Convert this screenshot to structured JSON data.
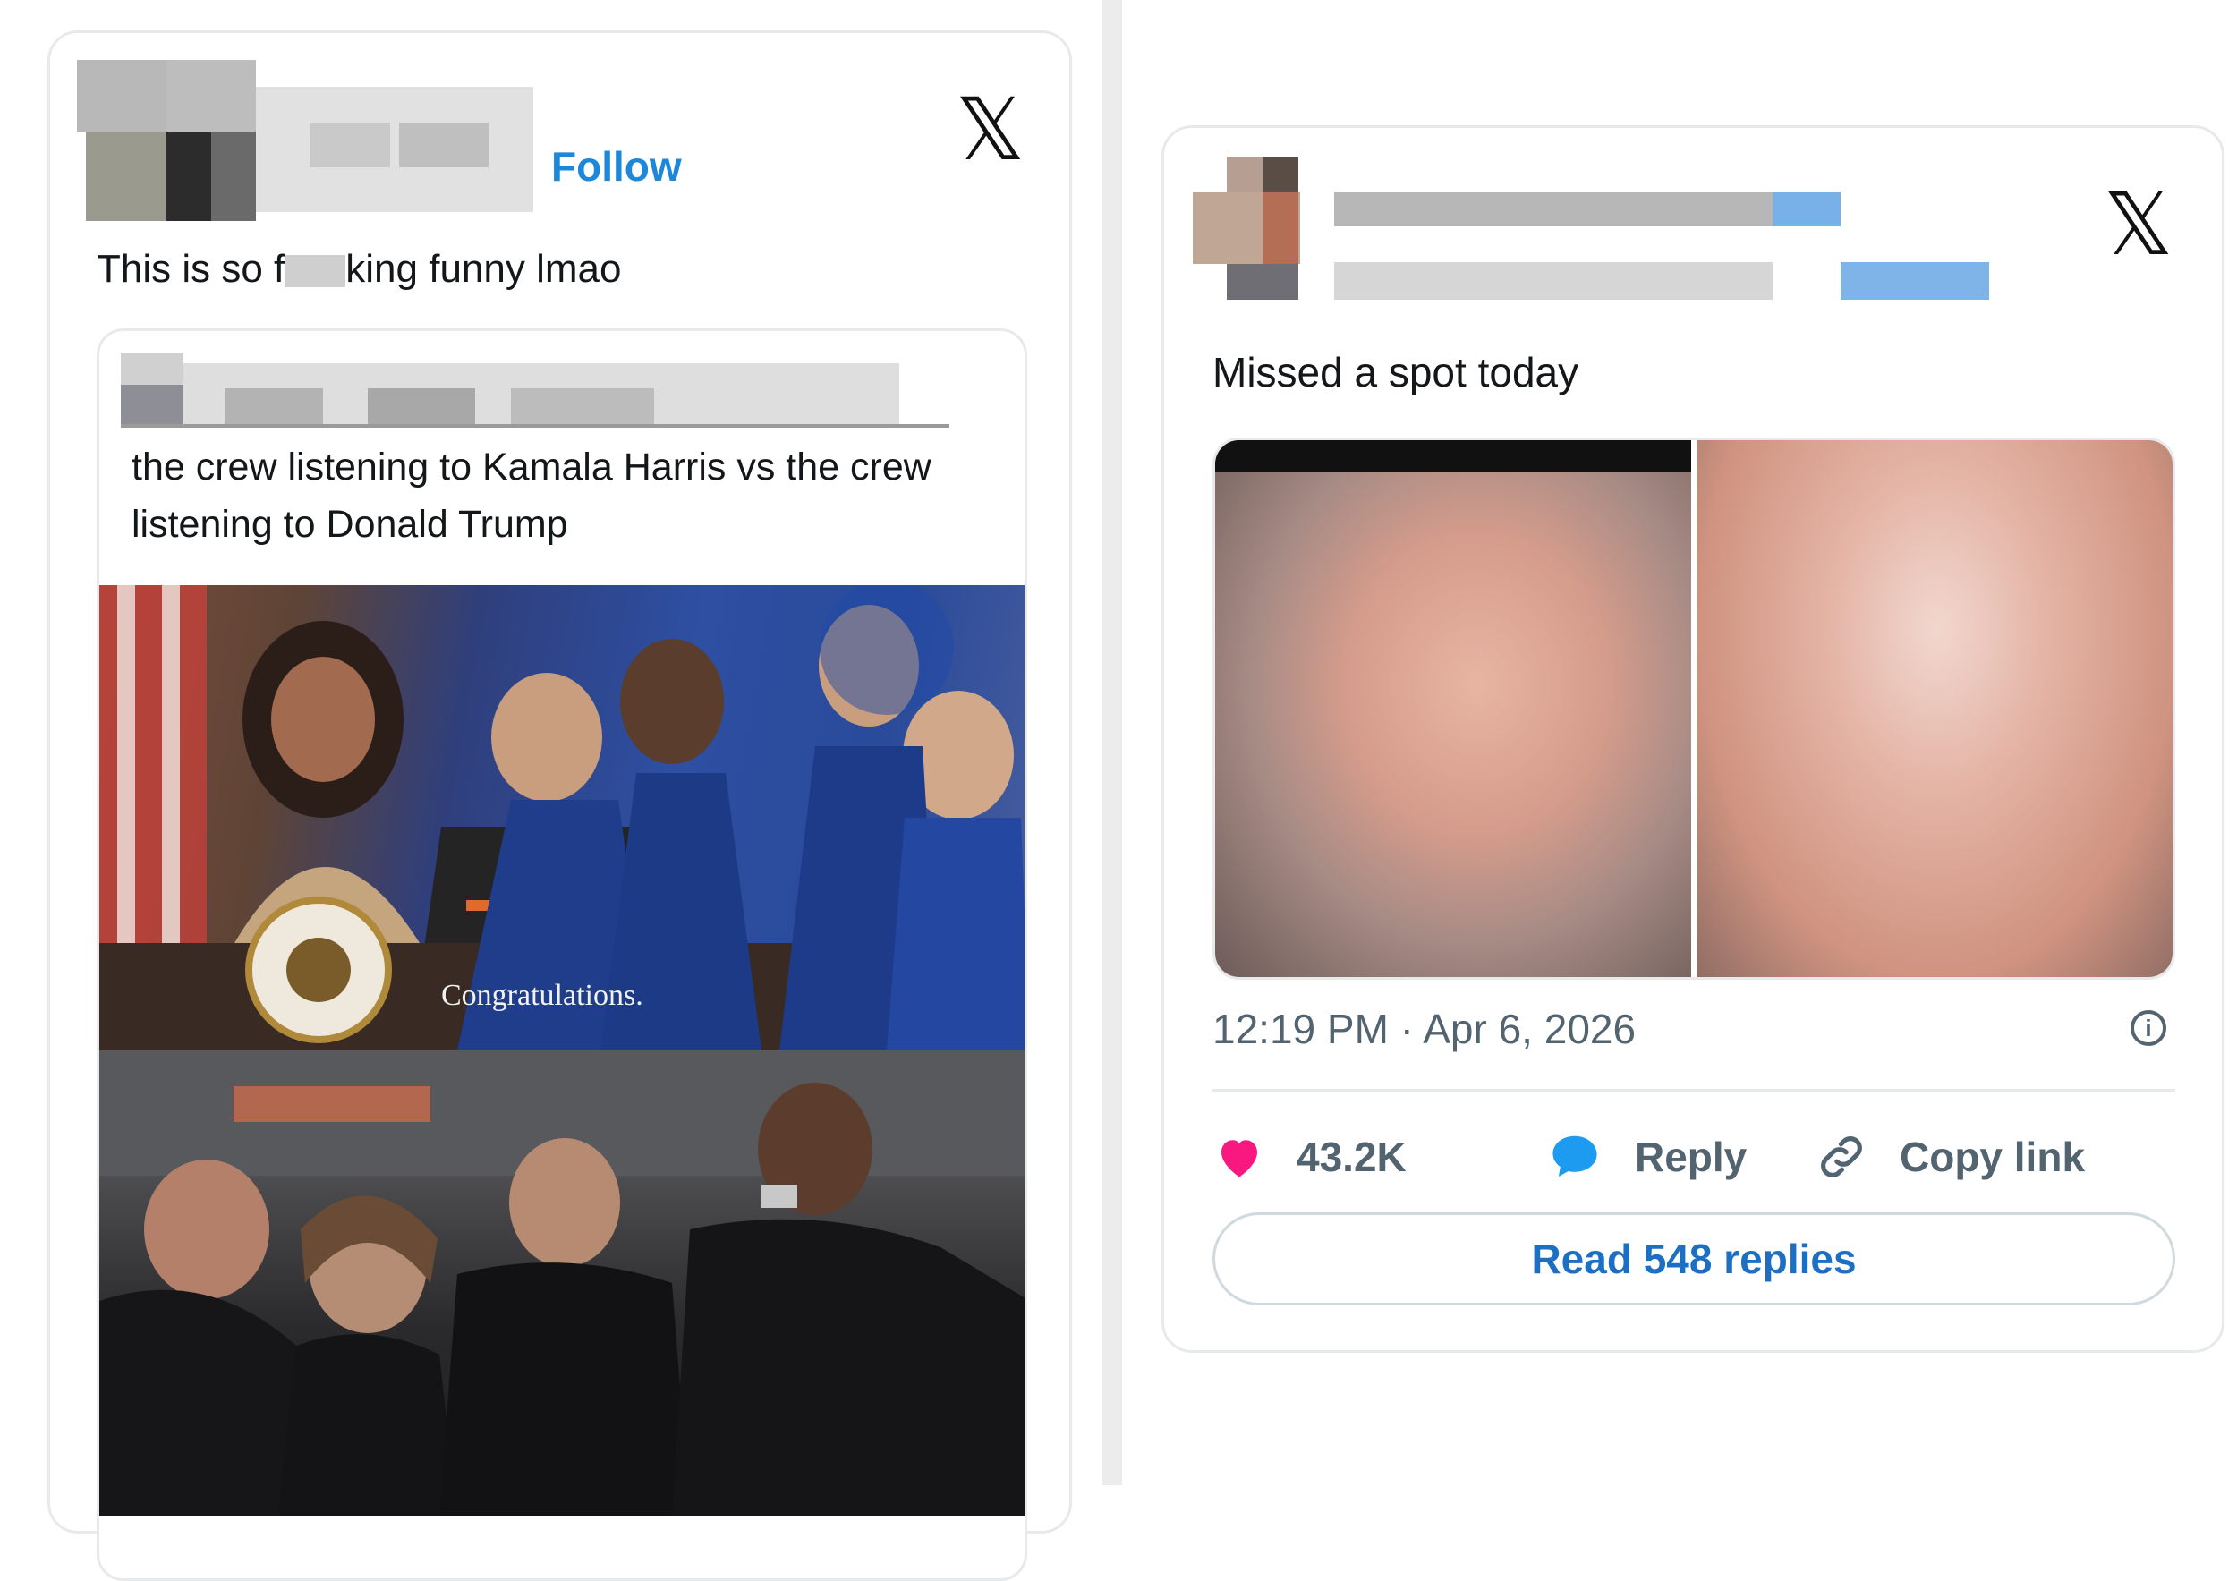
{
  "left_tweet": {
    "follow_label": "Follow",
    "text_before": "This is so f",
    "text_after": "king funny lmao",
    "quote": {
      "text": "the crew listening to Kamala Harris vs the crew listening to Donald Trump",
      "photo_caption": "Congratulations."
    },
    "logo_icon": "x-logo-icon"
  },
  "right_tweet": {
    "text": "Missed a spot today",
    "timestamp": "12:19 PM · Apr 6, 2026",
    "likes": "43.2K",
    "reply_label": "Reply",
    "copy_link_label": "Copy link",
    "read_replies_label": "Read 548 replies",
    "logo_icon": "x-logo-icon",
    "colors": {
      "heart": "#f91880",
      "reply": "#1d9bf0",
      "link_text": "#1d6fc4"
    }
  },
  "logo_glyph": "𝕏"
}
